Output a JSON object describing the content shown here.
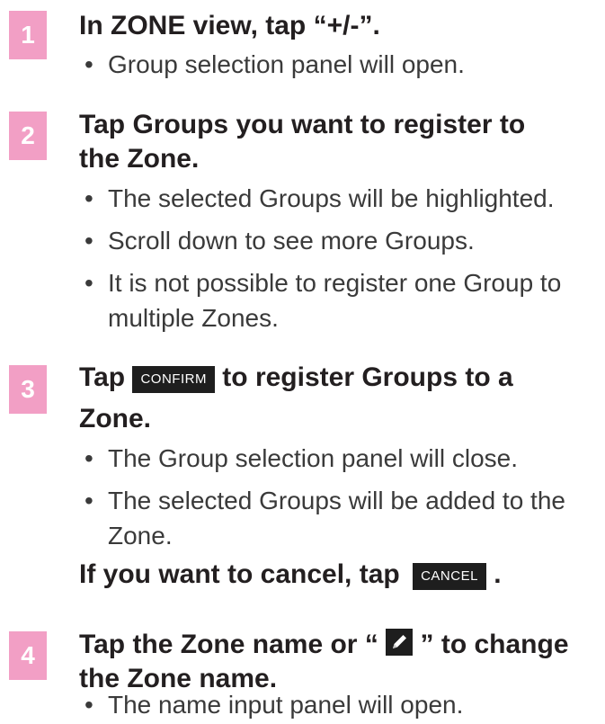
{
  "steps": [
    {
      "number": "1",
      "title": "In ZONE view, tap “+/-”.",
      "bullets": [
        "Group selection panel will open."
      ]
    },
    {
      "number": "2",
      "title_line1": "Tap Groups you want to register to",
      "title_line2": "the Zone.",
      "bullets": [
        "The selected Groups will be highlighted.",
        "Scroll down to see more Groups.",
        "It is not possible to register one Group to",
        "multiple Zones."
      ]
    },
    {
      "number": "3",
      "title_prefix": "Tap",
      "title_button": "CONFIRM",
      "title_suffix": "to register Groups to a",
      "title_line2": "Zone.",
      "bullets": [
        "The Group selection panel will close.",
        "The selected Groups will be added to the",
        "Zone."
      ],
      "cancel_text": "If you want to cancel, tap",
      "cancel_button": "CANCEL",
      "cancel_end": "."
    },
    {
      "number": "4",
      "title_prefix": "Tap the Zone name or “",
      "title_suffix": "” to change",
      "title_line2": "the Zone name.",
      "bullets": [
        "The name input panel will open."
      ]
    }
  ],
  "bullet_char": "•",
  "colors": {
    "accent": "#f29fc5",
    "button": "#1e1e1e",
    "text": "#231f20"
  }
}
